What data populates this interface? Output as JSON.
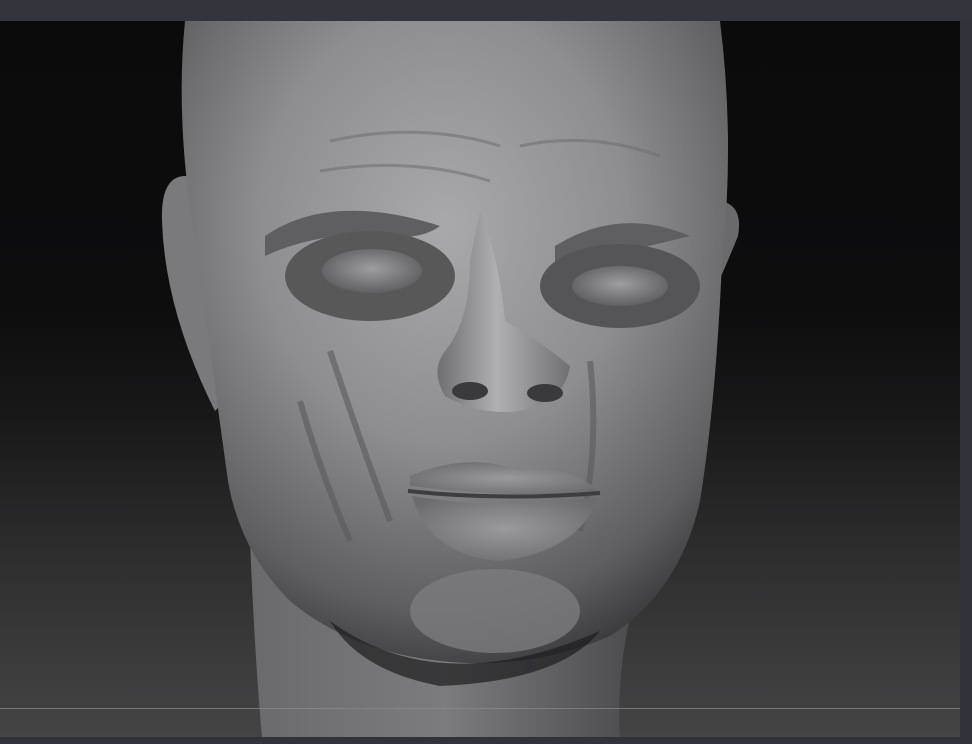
{
  "app": {
    "viewport": {
      "content": "sculpted-head-model",
      "background_top": "#0b0b0c",
      "background_bottom": "#444445",
      "floor_line_color": "#8a8a8c"
    },
    "colors": {
      "chrome": "#32333a",
      "clay": "#8c8c8e"
    }
  }
}
